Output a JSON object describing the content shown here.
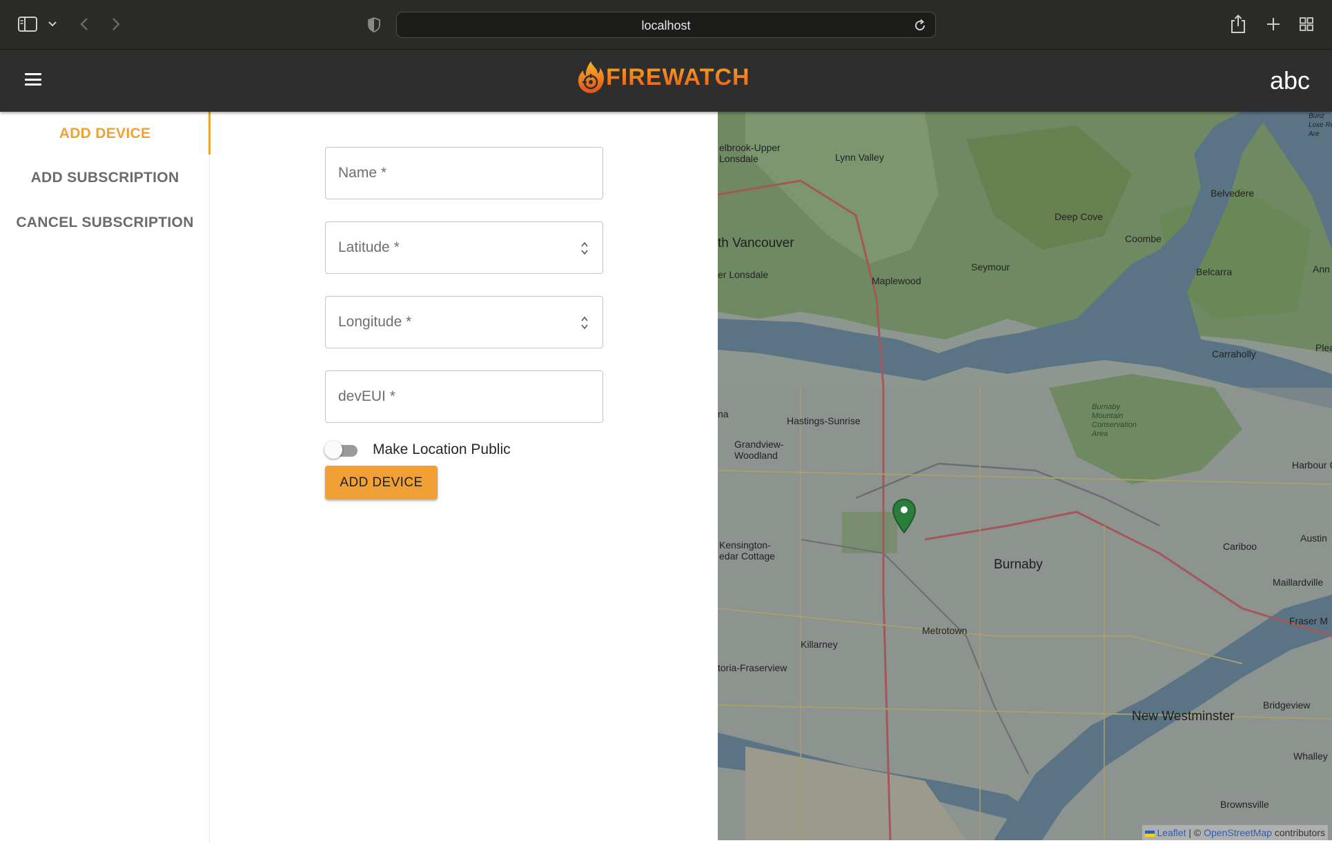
{
  "browser": {
    "url": "localhost"
  },
  "header": {
    "brand": "FIREWATCH",
    "user": "abc"
  },
  "nav": {
    "tabs": [
      {
        "label": "ADD DEVICE",
        "active": true
      },
      {
        "label": "ADD SUBSCRIPTION",
        "active": false
      },
      {
        "label": "CANCEL SUBSCRIPTION",
        "active": false
      }
    ]
  },
  "form": {
    "name_label": "Name *",
    "latitude_label": "Latitude *",
    "longitude_label": "Longitude *",
    "deveui_label": "devEUI *",
    "public_toggle_label": "Make Location Public",
    "public_toggle_on": false,
    "submit_label": "ADD DEVICE"
  },
  "map": {
    "places": {
      "brook_lonsdale": "elbrook-Upper\nLonsdale",
      "lynn_valley": "Lynn Valley",
      "n_vancouver": "th Vancouver",
      "lonsdale": "er Lonsdale",
      "maplewood": "Maplewood",
      "seymour": "Seymour",
      "deep_cove": "Deep Cove",
      "coombe": "Coombe",
      "belvedere": "Belvedere",
      "belcarra": "Belcarra",
      "carraholly": "Carraholly",
      "hastings": "Hastings-Sunrise",
      "grandview": "Grandview-\nWoodland",
      "kensington": "Kensington-\nedar Cottage",
      "burnaby": "Burnaby",
      "metrotown": "Metrotown",
      "killarney": "Killarney",
      "fraserview": "toria-Fraserview",
      "new_westminster": "New Westminster",
      "cariboo": "Cariboo",
      "maillardville": "Maillardville",
      "harbour": "Harbour Ch",
      "austin": "Austin",
      "fraser_mills": "Fraser M",
      "bridgeview": "Bridgeview",
      "whalley": "Whalley",
      "brownsville": "Brownsville",
      "burnaby_mountain": "Burnaby\nMountain\nConservation\nArea",
      "na": "na",
      "ple": "Plea",
      "ann": "Ann",
      "bunz": "Bunz\nLoxe Recr\nAre"
    },
    "attribution": {
      "leaflet": "Leaflet",
      "separator": " | © ",
      "osm": "OpenStreetMap",
      "suffix": " contributors"
    }
  }
}
